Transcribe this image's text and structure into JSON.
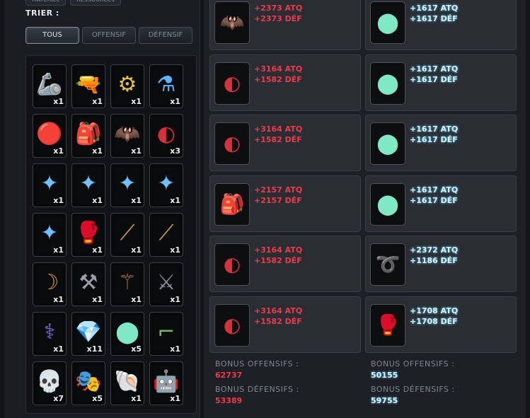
{
  "sort": {
    "top_tabs": [
      "Matériel",
      "Ressources"
    ],
    "label": "TRIER :",
    "filters": [
      "TOUS",
      "OFFENSIF",
      "DÉFENSIF"
    ],
    "active_filter": "TOUS"
  },
  "inventory": [
    {
      "icon": "mechanical-arm-icon",
      "glyph": "🦾",
      "qty": "x1",
      "color": "#9aa3ad"
    },
    {
      "icon": "shotgun-icon",
      "glyph": "🔫",
      "qty": "x1",
      "color": "#b5653a"
    },
    {
      "icon": "machine-part-icon",
      "glyph": "⚙",
      "qty": "x1",
      "color": "#e0c23c"
    },
    {
      "icon": "chemistry-flask-icon",
      "glyph": "⚗",
      "qty": "x1",
      "color": "#58b7ff"
    },
    {
      "icon": "red-orb-icon",
      "glyph": "🔴",
      "qty": "x1",
      "color": "#e02a3a"
    },
    {
      "icon": "harness-icon",
      "glyph": "🎒",
      "qty": "x1",
      "color": "#a86a45"
    },
    {
      "icon": "dark-figure-icon",
      "glyph": "🦇",
      "qty": "x1",
      "color": "#9aa0a8"
    },
    {
      "icon": "red-emblem-icon",
      "glyph": "◐",
      "qty": "x3",
      "color": "#d9303d"
    },
    {
      "icon": "blue-mace-icon",
      "glyph": "✦",
      "qty": "x1",
      "color": "#6cc2ff"
    },
    {
      "icon": "blue-mace-icon",
      "glyph": "✦",
      "qty": "x1",
      "color": "#6cc2ff"
    },
    {
      "icon": "blue-mace-icon",
      "glyph": "✦",
      "qty": "x1",
      "color": "#6cc2ff"
    },
    {
      "icon": "blue-mace-icon",
      "glyph": "✦",
      "qty": "x1",
      "color": "#6cc2ff"
    },
    {
      "icon": "blue-mace-icon",
      "glyph": "✦",
      "qty": "x1",
      "color": "#6cc2ff"
    },
    {
      "icon": "armored-gauntlet-icon",
      "glyph": "🥊",
      "qty": "x1",
      "color": "#d85a30"
    },
    {
      "icon": "golden-staff-icon",
      "glyph": "⟋",
      "qty": "x1",
      "color": "#d4a43a"
    },
    {
      "icon": "golden-staff-icon",
      "glyph": "⟋",
      "qty": "x1",
      "color": "#d4a43a"
    },
    {
      "icon": "golden-horn-icon",
      "glyph": "☽",
      "qty": "x1",
      "color": "#d09a2a"
    },
    {
      "icon": "spiked-club-icon",
      "glyph": "⚒",
      "qty": "x1",
      "color": "#9aa0a8"
    },
    {
      "icon": "scepter-icon",
      "glyph": "⚚",
      "qty": "x1",
      "color": "#b0774e"
    },
    {
      "icon": "dark-blade-icon",
      "glyph": "⚔",
      "qty": "x1",
      "color": "#8c939b"
    },
    {
      "icon": "ornate-staff-icon",
      "glyph": "⚕",
      "qty": "x1",
      "color": "#7d6fd6"
    },
    {
      "icon": "crystal-rock-icon",
      "glyph": "💎",
      "qty": "x11",
      "color": "#8fb2cf"
    },
    {
      "icon": "dark-orb-icon",
      "glyph": "⬤",
      "qty": "x5",
      "color": "#7fe8c5"
    },
    {
      "icon": "green-blaster-icon",
      "glyph": "⌐",
      "qty": "x1",
      "color": "#6bbf5a"
    },
    {
      "icon": "skull-mask-icon",
      "glyph": "💀",
      "qty": "x7",
      "color": "#e6dccb"
    },
    {
      "icon": "face-mask-icon",
      "glyph": "🎭",
      "qty": "x5",
      "color": "#e08a4a"
    },
    {
      "icon": "horn-icon",
      "glyph": "🐚",
      "qty": "x1",
      "color": "#c9b38e"
    },
    {
      "icon": "robotic-fist-icon",
      "glyph": "🤖",
      "qty": "x1",
      "color": "#c8cdd3"
    }
  ],
  "equipment": [
    {
      "icon": "dark-figure-icon",
      "glyph": "🦇",
      "atq": "+2373 ATQ",
      "def": "+2373 DÉF",
      "color": "red",
      "icon_color": "#b0b6bd"
    },
    {
      "icon": "black-orb-icon",
      "glyph": "⬤",
      "atq": "+1617 ATQ",
      "def": "+1617 DÉF",
      "color": "cyan",
      "icon_color": "#7fe8c5"
    },
    {
      "icon": "red-emblem-icon",
      "glyph": "◐",
      "atq": "+3164 ATQ",
      "def": "+1582 DÉF",
      "color": "red",
      "icon_color": "#d9303d"
    },
    {
      "icon": "black-orb-icon",
      "glyph": "⬤",
      "atq": "+1617 ATQ",
      "def": "+1617 DÉF",
      "color": "cyan",
      "icon_color": "#7fe8c5"
    },
    {
      "icon": "red-emblem-icon",
      "glyph": "◐",
      "atq": "+3164 ATQ",
      "def": "+1582 DÉF",
      "color": "red",
      "icon_color": "#d9303d"
    },
    {
      "icon": "black-orb-icon",
      "glyph": "⬤",
      "atq": "+1617 ATQ",
      "def": "+1617 DÉF",
      "color": "cyan",
      "icon_color": "#7fe8c5"
    },
    {
      "icon": "utility-belt-icon",
      "glyph": "🎒",
      "atq": "+2157 ATQ",
      "def": "+2157 DÉF",
      "color": "red",
      "icon_color": "#b58955"
    },
    {
      "icon": "black-orb-icon",
      "glyph": "⬤",
      "atq": "+1617 ATQ",
      "def": "+1617 DÉF",
      "color": "cyan",
      "icon_color": "#7fe8c5"
    },
    {
      "icon": "red-emblem-icon",
      "glyph": "◐",
      "atq": "+3164 ATQ",
      "def": "+1582 DÉF",
      "color": "red",
      "icon_color": "#d9303d"
    },
    {
      "icon": "red-loop-icon",
      "glyph": "➰",
      "atq": "+2372 ATQ",
      "def": "+1186 DÉF",
      "color": "cyan",
      "icon_color": "#d0303d"
    },
    {
      "icon": "red-emblem-icon",
      "glyph": "◐",
      "atq": "+3164 ATQ",
      "def": "+1582 DÉF",
      "color": "red",
      "icon_color": "#d9303d"
    },
    {
      "icon": "armored-gauntlet-icon",
      "glyph": "🥊",
      "atq": "+1708 ATQ",
      "def": "+1708 DÉF",
      "color": "cyan",
      "icon_color": "#d8a08a"
    }
  ],
  "bonus": {
    "left": {
      "offense_label": "BONUS OFFENSIFS :",
      "offense_value": "62737",
      "defense_label": "BONUS DÉFENSIFS :",
      "defense_value": "53389"
    },
    "right": {
      "offense_label": "BONUS OFFENSIFS :",
      "offense_value": "50155",
      "defense_label": "BONUS DÉFENSIFS :",
      "defense_value": "59755"
    }
  }
}
